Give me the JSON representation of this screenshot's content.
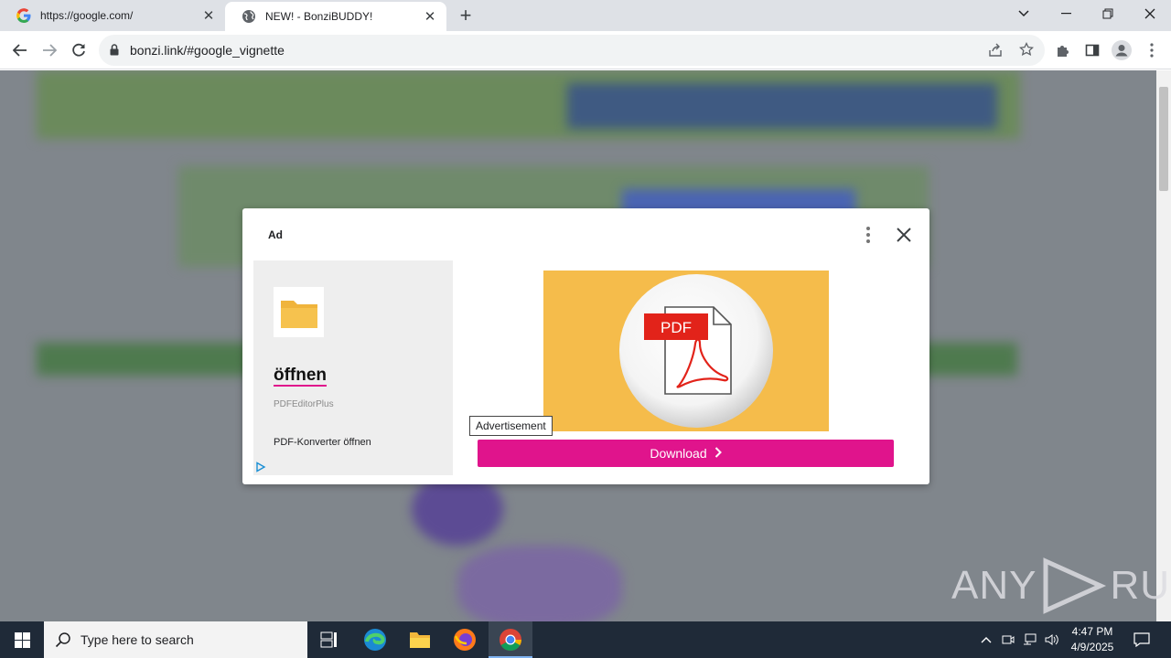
{
  "browser": {
    "tabs": [
      {
        "title": "https://google.com/",
        "favicon": "google-g-icon",
        "active": false
      },
      {
        "title": "NEW! - BonziBUDDY!",
        "favicon": "globe-icon",
        "active": true
      }
    ],
    "new_tab_label": "+",
    "url": "bonzi.link/#google_vignette"
  },
  "ad": {
    "label": "Ad",
    "headline": "öffnen",
    "advertiser": "PDFEditorPlus",
    "tagline": "PDF-Konverter öffnen",
    "tooltip": "Advertisement",
    "cta": "Download",
    "hero_badge": "PDF",
    "colors": {
      "cta": "#e0148c",
      "hero_bg": "#f5bc4b",
      "pdf_red": "#e2231a"
    }
  },
  "watermark": {
    "left": "ANY",
    "right": "RUN"
  },
  "taskbar": {
    "search_placeholder": "Type here to search",
    "time": "4:47 PM",
    "date": "4/9/2025",
    "apps": [
      "task-view-icon",
      "edge-icon",
      "file-explorer-icon",
      "firefox-icon",
      "chrome-icon"
    ]
  }
}
